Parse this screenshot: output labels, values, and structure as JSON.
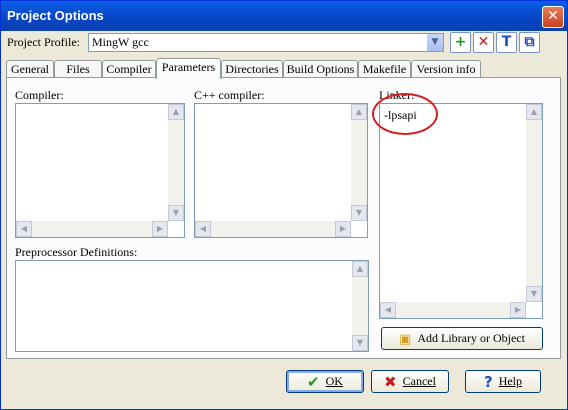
{
  "window": {
    "title": "Project Options",
    "close_glyph": "✕"
  },
  "profile": {
    "label": "Project Profile:",
    "value": "MingW gcc",
    "toolbar_icons": [
      "add-profile-icon",
      "delete-profile-icon",
      "rename-profile-icon",
      "copy-profile-icon"
    ],
    "toolbar_glyphs": [
      "+",
      "✕",
      "T",
      "⧉"
    ]
  },
  "tabs": [
    "General",
    "Files",
    "Compiler",
    "Parameters",
    "Directories",
    "Build Options",
    "Makefile",
    "Version info"
  ],
  "active_tab": "Parameters",
  "parameters": {
    "compiler_label": "Compiler:",
    "cpp_label": "C++ compiler:",
    "linker_label": "Linker:",
    "linker_text": "-lpsapi",
    "preprocessor_label": "Preprocessor Definitions:",
    "add_library_label": "Add Library or Object"
  },
  "buttons": {
    "ok": "OK",
    "cancel": "Cancel",
    "help": "Help"
  },
  "colors": {
    "titlebar": "#0a5ee8",
    "annotation_circle": "#d42020",
    "ok_icon": "#1f9a1f",
    "cancel_icon": "#c81e1e",
    "help_icon": "#1f4fb8"
  }
}
